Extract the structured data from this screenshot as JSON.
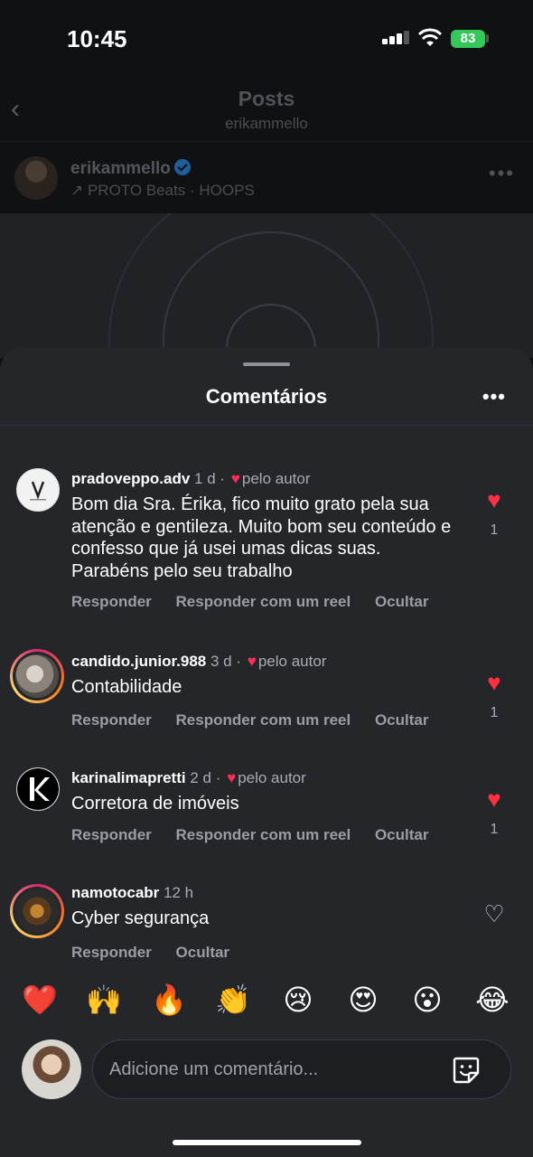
{
  "status_bar": {
    "time": "10:45",
    "battery": "83"
  },
  "nav": {
    "back_glyph": "‹",
    "title": "Posts",
    "subtitle": "erikammello"
  },
  "post": {
    "username": "erikammello",
    "audio": "↗ PROTO Beats · HOOPS",
    "more": "•••"
  },
  "sheet": {
    "title": "Comentários",
    "more": "•••"
  },
  "comments": [
    {
      "user": "pradoveppo.adv",
      "time": "1 d",
      "author_liked": "pelo autor",
      "text": "Bom dia Sra. Érika, fico muito grato pela sua atenção e gentileza. Muito bom seu conteúdo e confesso que já usei umas dicas suas. Parabéns pelo seu trabalho",
      "actions": [
        "Responder",
        "Responder com um reel",
        "Ocultar"
      ],
      "liked": true,
      "likes": "1"
    },
    {
      "user": "candido.junior.988",
      "time": "3 d",
      "author_liked": "pelo autor",
      "text": "Contabilidade",
      "actions": [
        "Responder",
        "Responder com um reel",
        "Ocultar"
      ],
      "liked": true,
      "likes": "1"
    },
    {
      "user": "karinalimapretti",
      "time": "2 d",
      "author_liked": "pelo autor",
      "text": "Corretora de imóveis",
      "actions": [
        "Responder",
        "Responder com um reel",
        "Ocultar"
      ],
      "liked": true,
      "likes": "1"
    },
    {
      "user": "namotocabr",
      "time": "12 h",
      "text": "Cyber segurança",
      "actions": [
        "Responder",
        "Ocultar"
      ],
      "liked": false
    }
  ],
  "quick_reactions": [
    "❤️",
    "🙌",
    "🔥",
    "👏",
    "😢",
    "😍",
    "😮",
    "😂"
  ],
  "composer": {
    "placeholder": "Adicione um comentário..."
  },
  "icons": {
    "back": "chevron-left-icon",
    "verified": "verified-badge-icon",
    "heart": "heart-icon",
    "sticker": "sticker-icon"
  },
  "colors": {
    "like": "#ff3040",
    "battery": "#34c759",
    "sheet_bg": "#24262a"
  }
}
